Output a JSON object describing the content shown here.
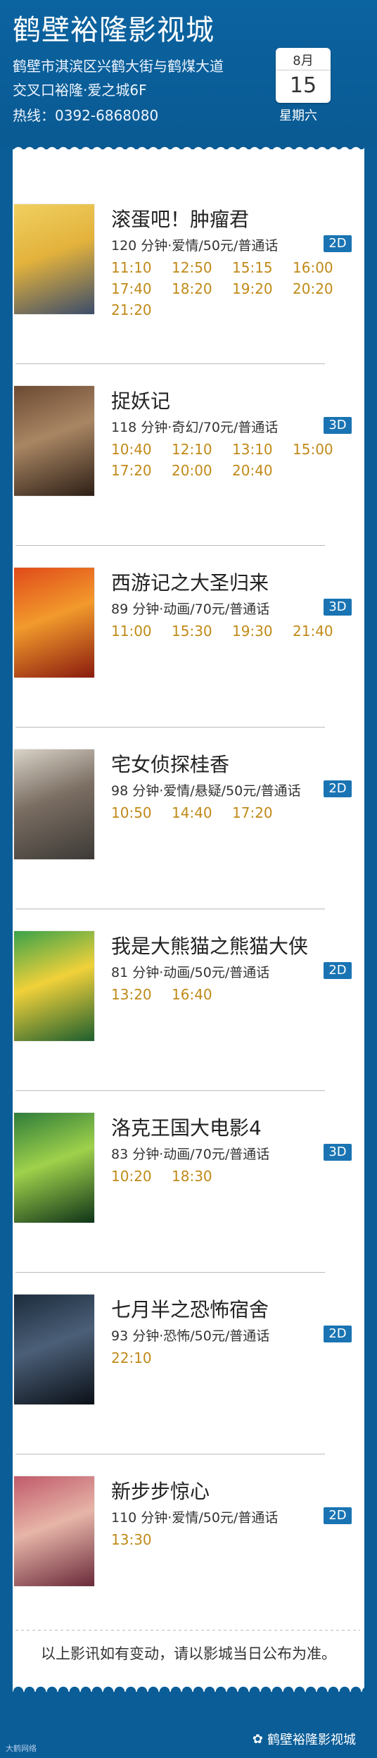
{
  "header": {
    "cinema_name": "鹤壁裕隆影视城",
    "address_line1": "鹤壁市淇滨区兴鹤大街与鹤煤大道",
    "address_line2": "交叉口裕隆·爱之城6F",
    "hotline": "热线：0392-6868080",
    "date_month": "8月",
    "date_day": "15",
    "weekday": "星期六"
  },
  "movies": [
    {
      "title": "滚蛋吧！肿瘤君",
      "info": "120 分钟·爱情/50元/普通话",
      "format": "2D",
      "times": [
        "11:10",
        "12:50",
        "15:15",
        "16:00",
        "17:40",
        "18:20",
        "19:20",
        "20:20",
        "21:20"
      ],
      "poster_colors": [
        "#f0d060",
        "#e3b23c",
        "#3b4c6b"
      ]
    },
    {
      "title": "捉妖记",
      "info": "118 分钟·奇幻/70元/普通话",
      "format": "3D",
      "times": [
        "10:40",
        "12:10",
        "13:10",
        "15:00",
        "17:20",
        "20:00",
        "20:40"
      ],
      "poster_colors": [
        "#6c4a33",
        "#a98663",
        "#2d1f16"
      ]
    },
    {
      "title": "西游记之大圣归来",
      "info": "89 分钟·动画/70元/普通话",
      "format": "3D",
      "times": [
        "11:00",
        "15:30",
        "19:30",
        "21:40"
      ],
      "poster_colors": [
        "#e04a1a",
        "#f29a2c",
        "#8a1b0e"
      ]
    },
    {
      "title": "宅女侦探桂香",
      "info": "98 分钟·爱情/悬疑/50元/普通话",
      "format": "2D",
      "times": [
        "10:50",
        "14:40",
        "17:20"
      ],
      "poster_colors": [
        "#d9d3c7",
        "#7b6e63",
        "#3d3a36"
      ]
    },
    {
      "title": "我是大熊猫之熊猫大侠",
      "info": "81 分钟·动画/50元/普通话",
      "format": "2D",
      "times": [
        "13:20",
        "16:40"
      ],
      "poster_colors": [
        "#3aa24a",
        "#f1d13a",
        "#1d5e2e"
      ]
    },
    {
      "title": "洛克王国大电影4",
      "info": "83 分钟·动画/70元/普通话",
      "format": "3D",
      "times": [
        "10:20",
        "18:30"
      ],
      "poster_colors": [
        "#2f7d3a",
        "#9fd14b",
        "#0f3418"
      ]
    },
    {
      "title": "七月半之恐怖宿舍",
      "info": "93 分钟·恐怖/50元/普通话",
      "format": "2D",
      "times": [
        "22:10"
      ],
      "poster_colors": [
        "#1c2c3c",
        "#4b5f78",
        "#0b1017"
      ]
    },
    {
      "title": "新步步惊心",
      "info": "110 分钟·爱情/50元/普通话",
      "format": "2D",
      "times": [
        "13:30"
      ],
      "poster_colors": [
        "#c05a6a",
        "#e7b5a8",
        "#6a2a3a"
      ]
    }
  ],
  "notice": "以上影讯如有变动，请以影城当日公布为准。",
  "footer_account": "鹤壁裕隆影视城",
  "watermark": "大鹤网络"
}
